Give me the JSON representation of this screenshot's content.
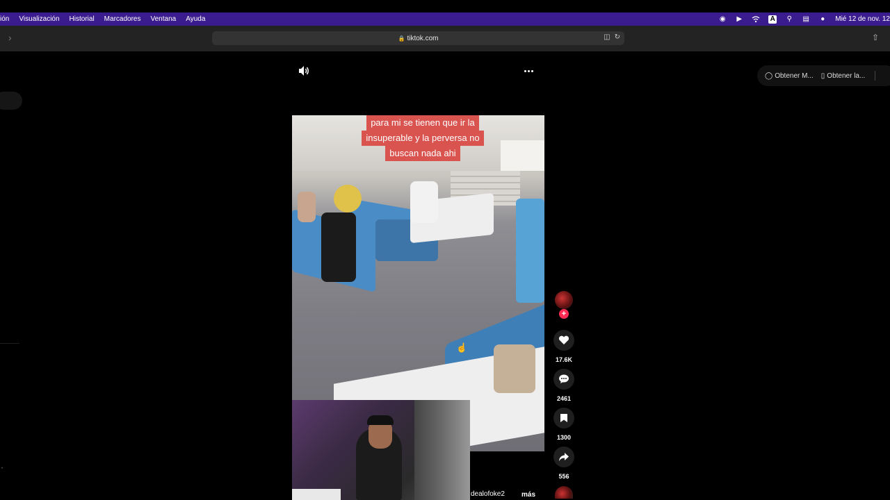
{
  "menubar": {
    "items": [
      "ión",
      "Visualización",
      "Historial",
      "Marcadores",
      "Ventana",
      "Ayuda"
    ],
    "clock": "Mié 12 de nov. 12",
    "status_icons": [
      "ai-assistant-icon",
      "play-circle-icon",
      "wifi-icon",
      "keyboard-input-icon",
      "search-icon",
      "control-center-icon",
      "siri-icon"
    ],
    "input_label": "A"
  },
  "browser": {
    "url": "tiktok.com",
    "lock_icon": "lock-icon"
  },
  "get_bar": {
    "btn1": "Obtener M...",
    "btn2": "Obtener la..."
  },
  "video": {
    "caption": [
      "para mi se tienen que ir la",
      "insuperable y la perversa no",
      "buscan nada ahi"
    ],
    "username": "dealofoke2",
    "more": "más"
  },
  "actions": {
    "likes": "17.6K",
    "comments": "2461",
    "saves": "1300",
    "shares": "556"
  },
  "colors": {
    "menubar_accent": "#3a1c8e",
    "follow": "#fe2c55",
    "caption_bg": "#d9534f"
  }
}
